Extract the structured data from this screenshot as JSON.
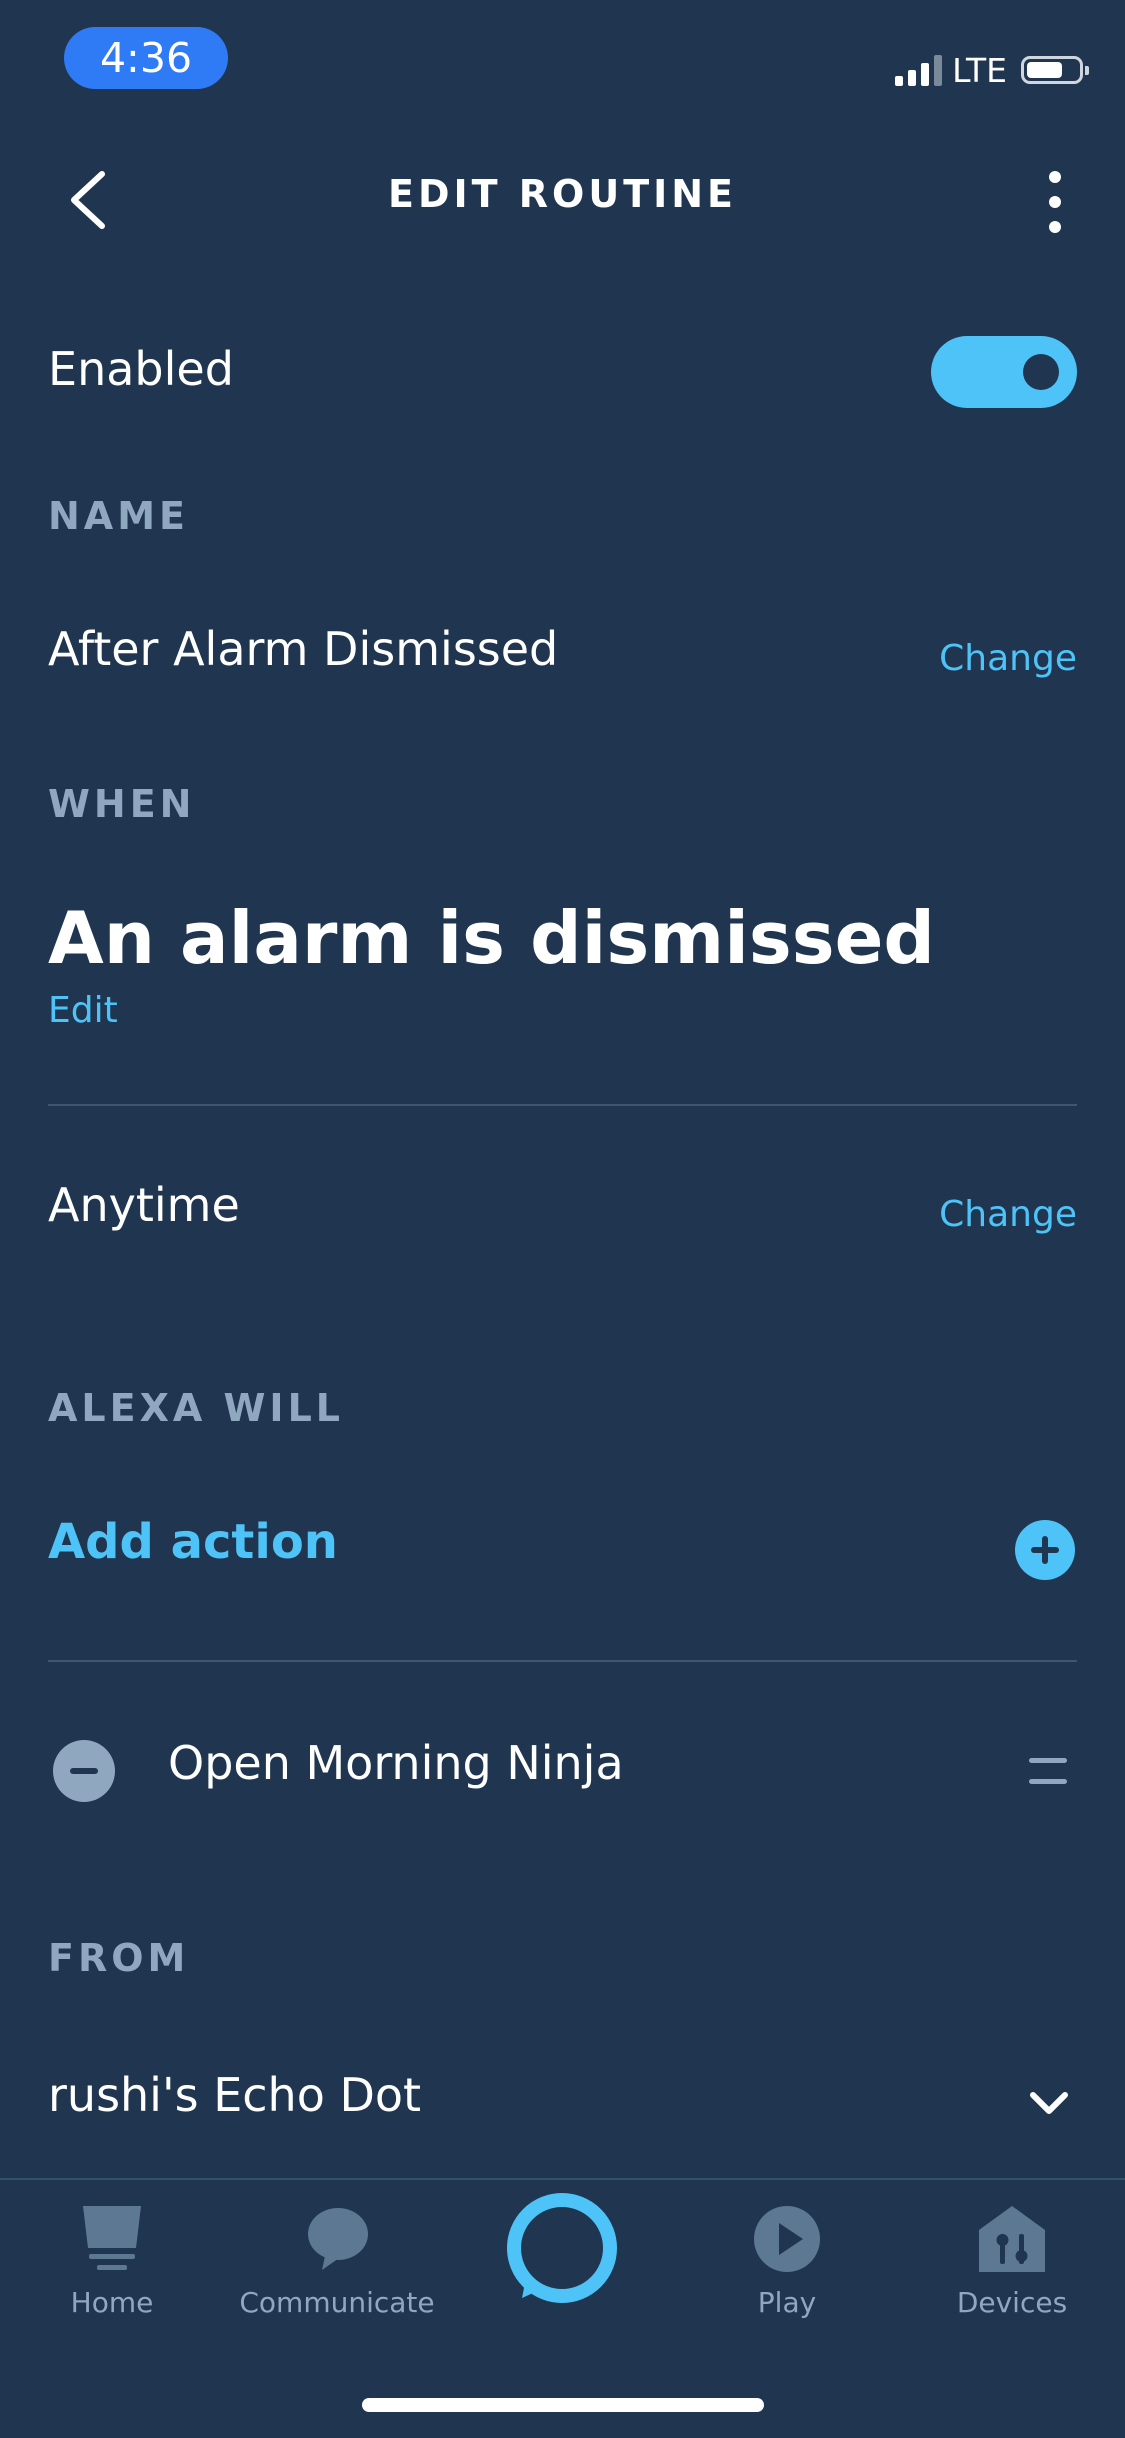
{
  "status_bar": {
    "time": "4:36",
    "network": "LTE"
  },
  "header": {
    "title": "EDIT ROUTINE"
  },
  "enabled": {
    "label": "Enabled",
    "on": true
  },
  "name_section": {
    "label": "NAME",
    "value": "After Alarm Dismissed",
    "change_label": "Change"
  },
  "when_section": {
    "label": "WHEN",
    "trigger": "An alarm is dismissed",
    "edit_label": "Edit",
    "schedule": "Anytime",
    "change_label": "Change"
  },
  "actions_section": {
    "label": "ALEXA WILL",
    "add_label": "Add action",
    "items": [
      {
        "label": "Open Morning Ninja"
      }
    ]
  },
  "from_section": {
    "label": "FROM",
    "device": "rushi's Echo Dot"
  },
  "tabbar": {
    "tabs": [
      {
        "label": "Home",
        "icon": "home-icon"
      },
      {
        "label": "Communicate",
        "icon": "speech-bubble-icon"
      },
      {
        "label": "",
        "icon": "alexa-ring-icon"
      },
      {
        "label": "Play",
        "icon": "play-icon"
      },
      {
        "label": "Devices",
        "icon": "devices-icon"
      }
    ]
  },
  "colors": {
    "background": "#203650",
    "accent": "#4ec3f7",
    "muted": "#8fa8c0"
  }
}
